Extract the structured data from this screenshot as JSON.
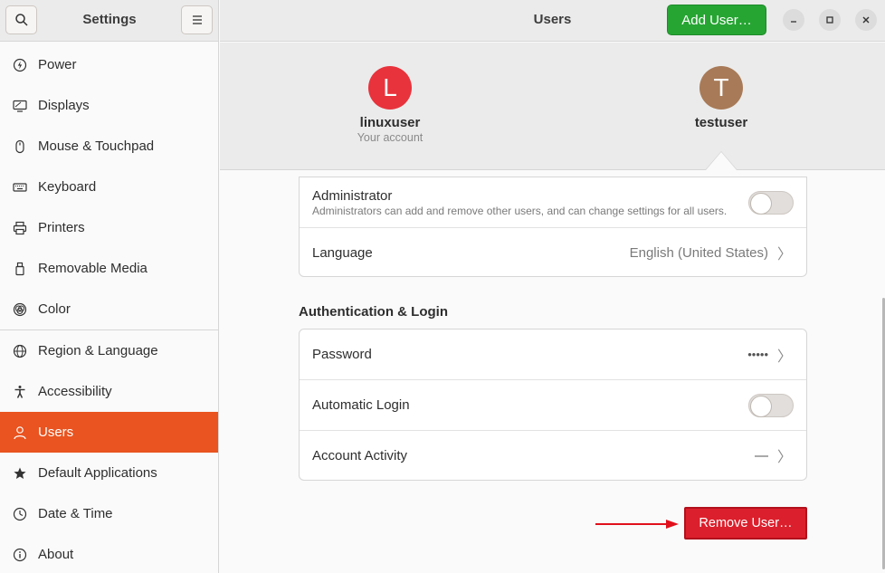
{
  "sidebar": {
    "title": "Settings",
    "items": [
      {
        "label": "Power",
        "icon": "power-icon"
      },
      {
        "label": "Displays",
        "icon": "display-icon"
      },
      {
        "label": "Mouse & Touchpad",
        "icon": "mouse-icon"
      },
      {
        "label": "Keyboard",
        "icon": "keyboard-icon"
      },
      {
        "label": "Printers",
        "icon": "printer-icon"
      },
      {
        "label": "Removable Media",
        "icon": "usb-drive-icon"
      },
      {
        "label": "Color",
        "icon": "color-icon"
      },
      {
        "label": "Region & Language",
        "icon": "globe-icon"
      },
      {
        "label": "Accessibility",
        "icon": "accessibility-icon"
      },
      {
        "label": "Users",
        "icon": "users-icon",
        "active": true
      },
      {
        "label": "Default Applications",
        "icon": "star-icon"
      },
      {
        "label": "Date & Time",
        "icon": "clock-icon"
      },
      {
        "label": "About",
        "icon": "info-icon"
      }
    ]
  },
  "header": {
    "title": "Users",
    "add_user_label": "Add User…"
  },
  "users": [
    {
      "initial": "L",
      "name": "linuxuser",
      "subtitle": "Your account",
      "color": "#e8333c"
    },
    {
      "initial": "T",
      "name": "testuser",
      "subtitle": "",
      "color": "#a87a57"
    }
  ],
  "account": {
    "administrator_label": "Administrator",
    "administrator_desc": "Administrators can add and remove other users, and can change settings for all users.",
    "language_label": "Language",
    "language_value": "English (United States)"
  },
  "auth": {
    "section_title": "Authentication & Login",
    "password_label": "Password",
    "password_value": "•••••",
    "autologin_label": "Automatic Login",
    "activity_label": "Account Activity",
    "activity_value": "—"
  },
  "remove_user_label": "Remove User…",
  "colors": {
    "accent": "#e95420",
    "add_button": "#26a533",
    "remove_button": "#dc1f2c"
  }
}
